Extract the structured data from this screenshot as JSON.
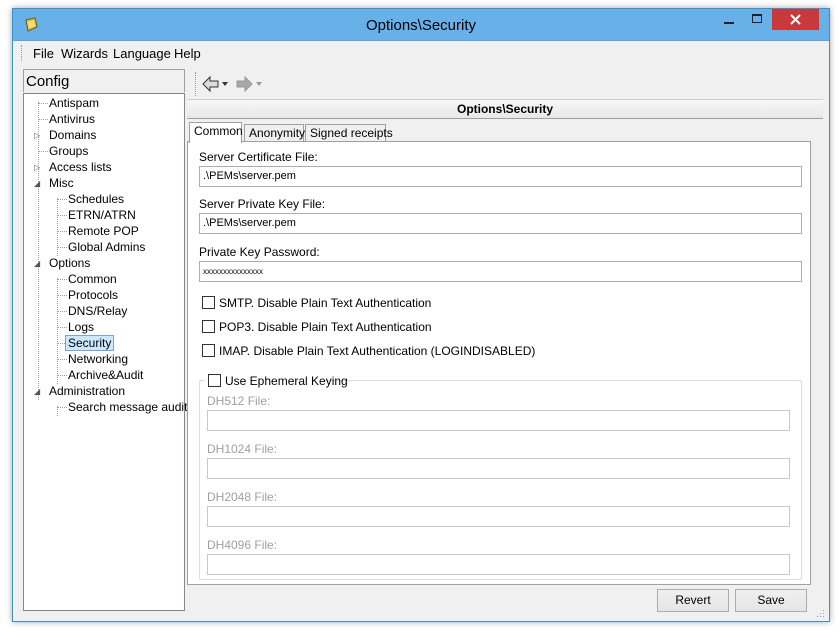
{
  "window": {
    "title": "Options\\Security",
    "controls": [
      "minimize-icon",
      "maximize-icon",
      "close-icon"
    ],
    "close_color": "#c7393a",
    "titlebar_color": "#67b0e8"
  },
  "menu": {
    "items": [
      "File",
      "Wizards",
      "Language",
      "Help"
    ]
  },
  "sidebar": {
    "header": "Config",
    "items": [
      {
        "label": "Antispam"
      },
      {
        "label": "Antivirus"
      },
      {
        "label": "Domains"
      },
      {
        "label": "Groups"
      },
      {
        "label": "Access lists"
      },
      {
        "label": "Misc"
      },
      {
        "label": "Schedules"
      },
      {
        "label": "ETRN/ATRN"
      },
      {
        "label": "Remote POP"
      },
      {
        "label": "Global Admins"
      },
      {
        "label": "Options"
      },
      {
        "label": "Common"
      },
      {
        "label": "Protocols"
      },
      {
        "label": "DNS/Relay"
      },
      {
        "label": "Logs"
      },
      {
        "label": "Security"
      },
      {
        "label": "Networking"
      },
      {
        "label": "Archive&Audit"
      },
      {
        "label": "Administration"
      },
      {
        "label": "Search message audit"
      }
    ],
    "selected": "Security"
  },
  "toolbar": {
    "back_icon": "back-arrow-icon",
    "forward_icon": "forward-arrow-icon"
  },
  "panel": {
    "title": "Options\\Security",
    "tabs": [
      "Common",
      "Anonymity",
      "Signed receipts"
    ],
    "active_tab": "Common"
  },
  "form": {
    "cert_label": "Server Certificate File:",
    "cert_value": ".\\PEMs\\server.pem",
    "key_label": "Server Private Key File:",
    "key_value": ".\\PEMs\\server.pem",
    "password_label": "Private Key Password:",
    "password_value": "xxxxxxxxxxxxxxx",
    "smtp_label": "SMTP. Disable Plain Text Authentication",
    "pop3_label": "POP3. Disable Plain Text Authentication",
    "imap_label": "IMAP. Disable Plain Text Authentication (LOGINDISABLED)",
    "ephemeral_label": "Use Ephemeral Keying",
    "dh512_label": "DH512 File:",
    "dh1024_label": "DH1024 File:",
    "dh2048_label": "DH2048 File:",
    "dh4096_label": "DH4096 File:"
  },
  "buttons": {
    "revert": "Revert",
    "save": "Save"
  }
}
